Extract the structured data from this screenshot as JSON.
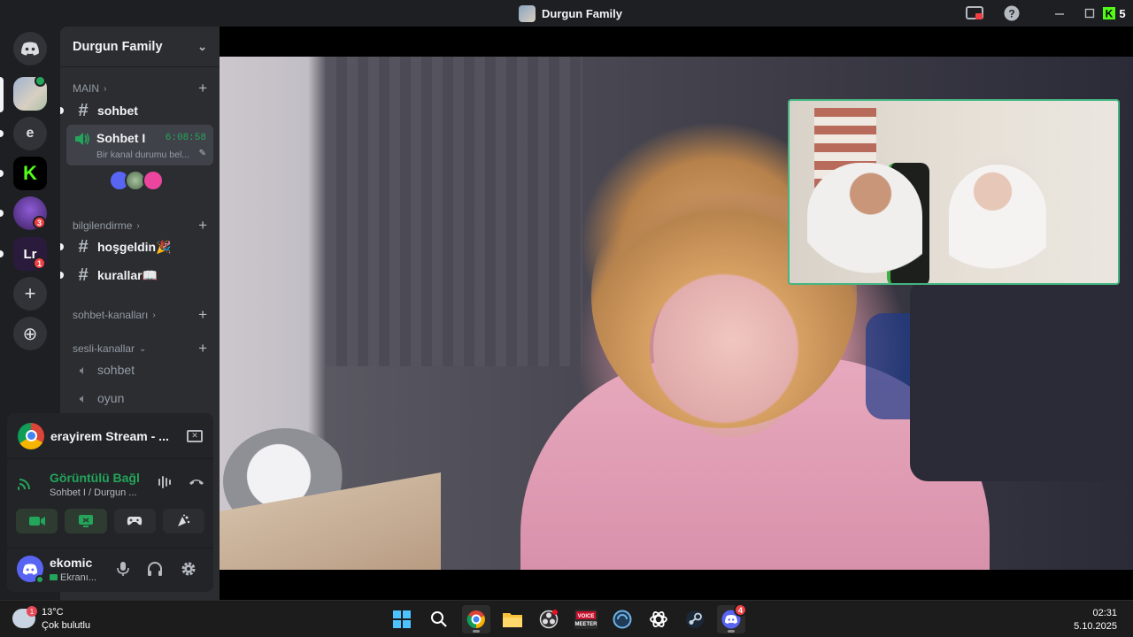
{
  "window": {
    "title": "Durgun Family"
  },
  "rail": {
    "servers": [
      {
        "name": "discord-home",
        "label": ""
      },
      {
        "name": "durgun-family",
        "label": ""
      },
      {
        "name": "server-e",
        "label": "e"
      },
      {
        "name": "server-kick",
        "label": "K"
      },
      {
        "name": "server-purple",
        "label": "",
        "badge": "3"
      },
      {
        "name": "server-lr",
        "label": "Lr",
        "badge": "1"
      }
    ],
    "add_label": "+",
    "explore_label": "⊕"
  },
  "sidebar": {
    "server_name": "Durgun Family",
    "categories": [
      {
        "label": "MAIN",
        "chev": "›"
      },
      {
        "label": "bilgilendirme",
        "chev": "›"
      },
      {
        "label": "sohbet-kanalları",
        "chev": "›"
      },
      {
        "label": "sesli-kanallar",
        "chev": "⌄"
      }
    ],
    "channels": [
      {
        "label": "sohbet"
      },
      {
        "label": "hoşgeldin🎉"
      },
      {
        "label": "kurallar📖"
      }
    ],
    "voice_active": {
      "label": "Sohbet I",
      "time": "6:08:58",
      "status": "Bir kanal durumu bel..."
    },
    "voice_channels": [
      {
        "label": "sohbet"
      },
      {
        "label": "oyun"
      }
    ]
  },
  "panel": {
    "stream_title": "erayirem Stream - ...",
    "connection_title": "Görüntülü Bağl",
    "connection_sub": "Sohbet I / Durgun ...",
    "user_name": "ekomic",
    "user_status": "Ekranı..."
  },
  "taskbar": {
    "weather_temp": "13°C",
    "weather_desc": "Çok bulutlu",
    "weather_badge": "1",
    "discord_badge": "4",
    "time": "02:31",
    "date": "5.10.2025",
    "voicemeeter_label": "VOICE MEETER"
  },
  "colors": {
    "accent": "#5865f2",
    "online": "#23a55a",
    "danger": "#f23f43",
    "pip_border": "#43b581"
  }
}
